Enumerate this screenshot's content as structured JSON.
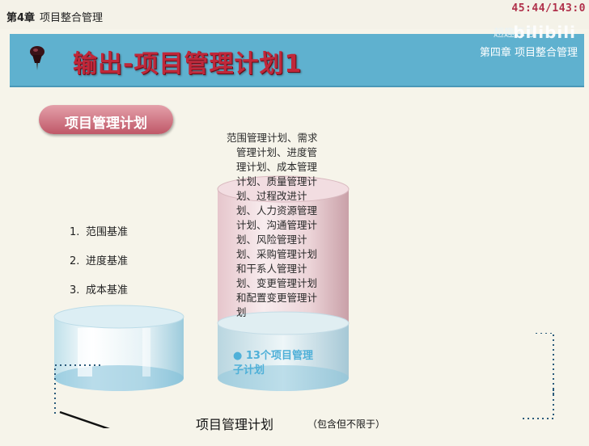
{
  "top_bar": {
    "chapter_number": "第4章",
    "chapter_topic": "项目整合管理",
    "timer": "45:44/143:0"
  },
  "banner": {
    "title": "输出-项目管理计划1",
    "watermark_text": "趙趣忑号",
    "watermark_logo": "bilibili",
    "chapter_label": "第四章  项目整合管理",
    "icon": "pushpin-icon"
  },
  "section_badge": "项目管理计划",
  "baselines": [
    {
      "num": "1.",
      "label": "范围基准"
    },
    {
      "num": "2.",
      "label": "进度基准"
    },
    {
      "num": "3.",
      "label": "成本基准"
    }
  ],
  "plan_text_lines": [
    "范围管理计划、需求",
    "管理计划、进度管",
    "理计划、成本管理",
    "计划、质量管理计",
    "划、过程改进计",
    "划、人力资源管理",
    "计划、沟通管理计",
    "划、风险管理计",
    "划、采购管理计划",
    "和干系人管理计",
    "划、变更管理计划",
    "和配置变更管理计",
    "划"
  ],
  "sub_plans": {
    "line1": "● 13个项目管理",
    "line2": "子计划"
  },
  "bottom": {
    "caption": "项目管理计划",
    "note": "（包含但不限于）"
  },
  "colors": {
    "banner": "#5fb1cf",
    "title_red": "#c0283a",
    "badge": "#c05868",
    "accent_blue": "#4fb0d8",
    "timer": "#b0304a"
  }
}
